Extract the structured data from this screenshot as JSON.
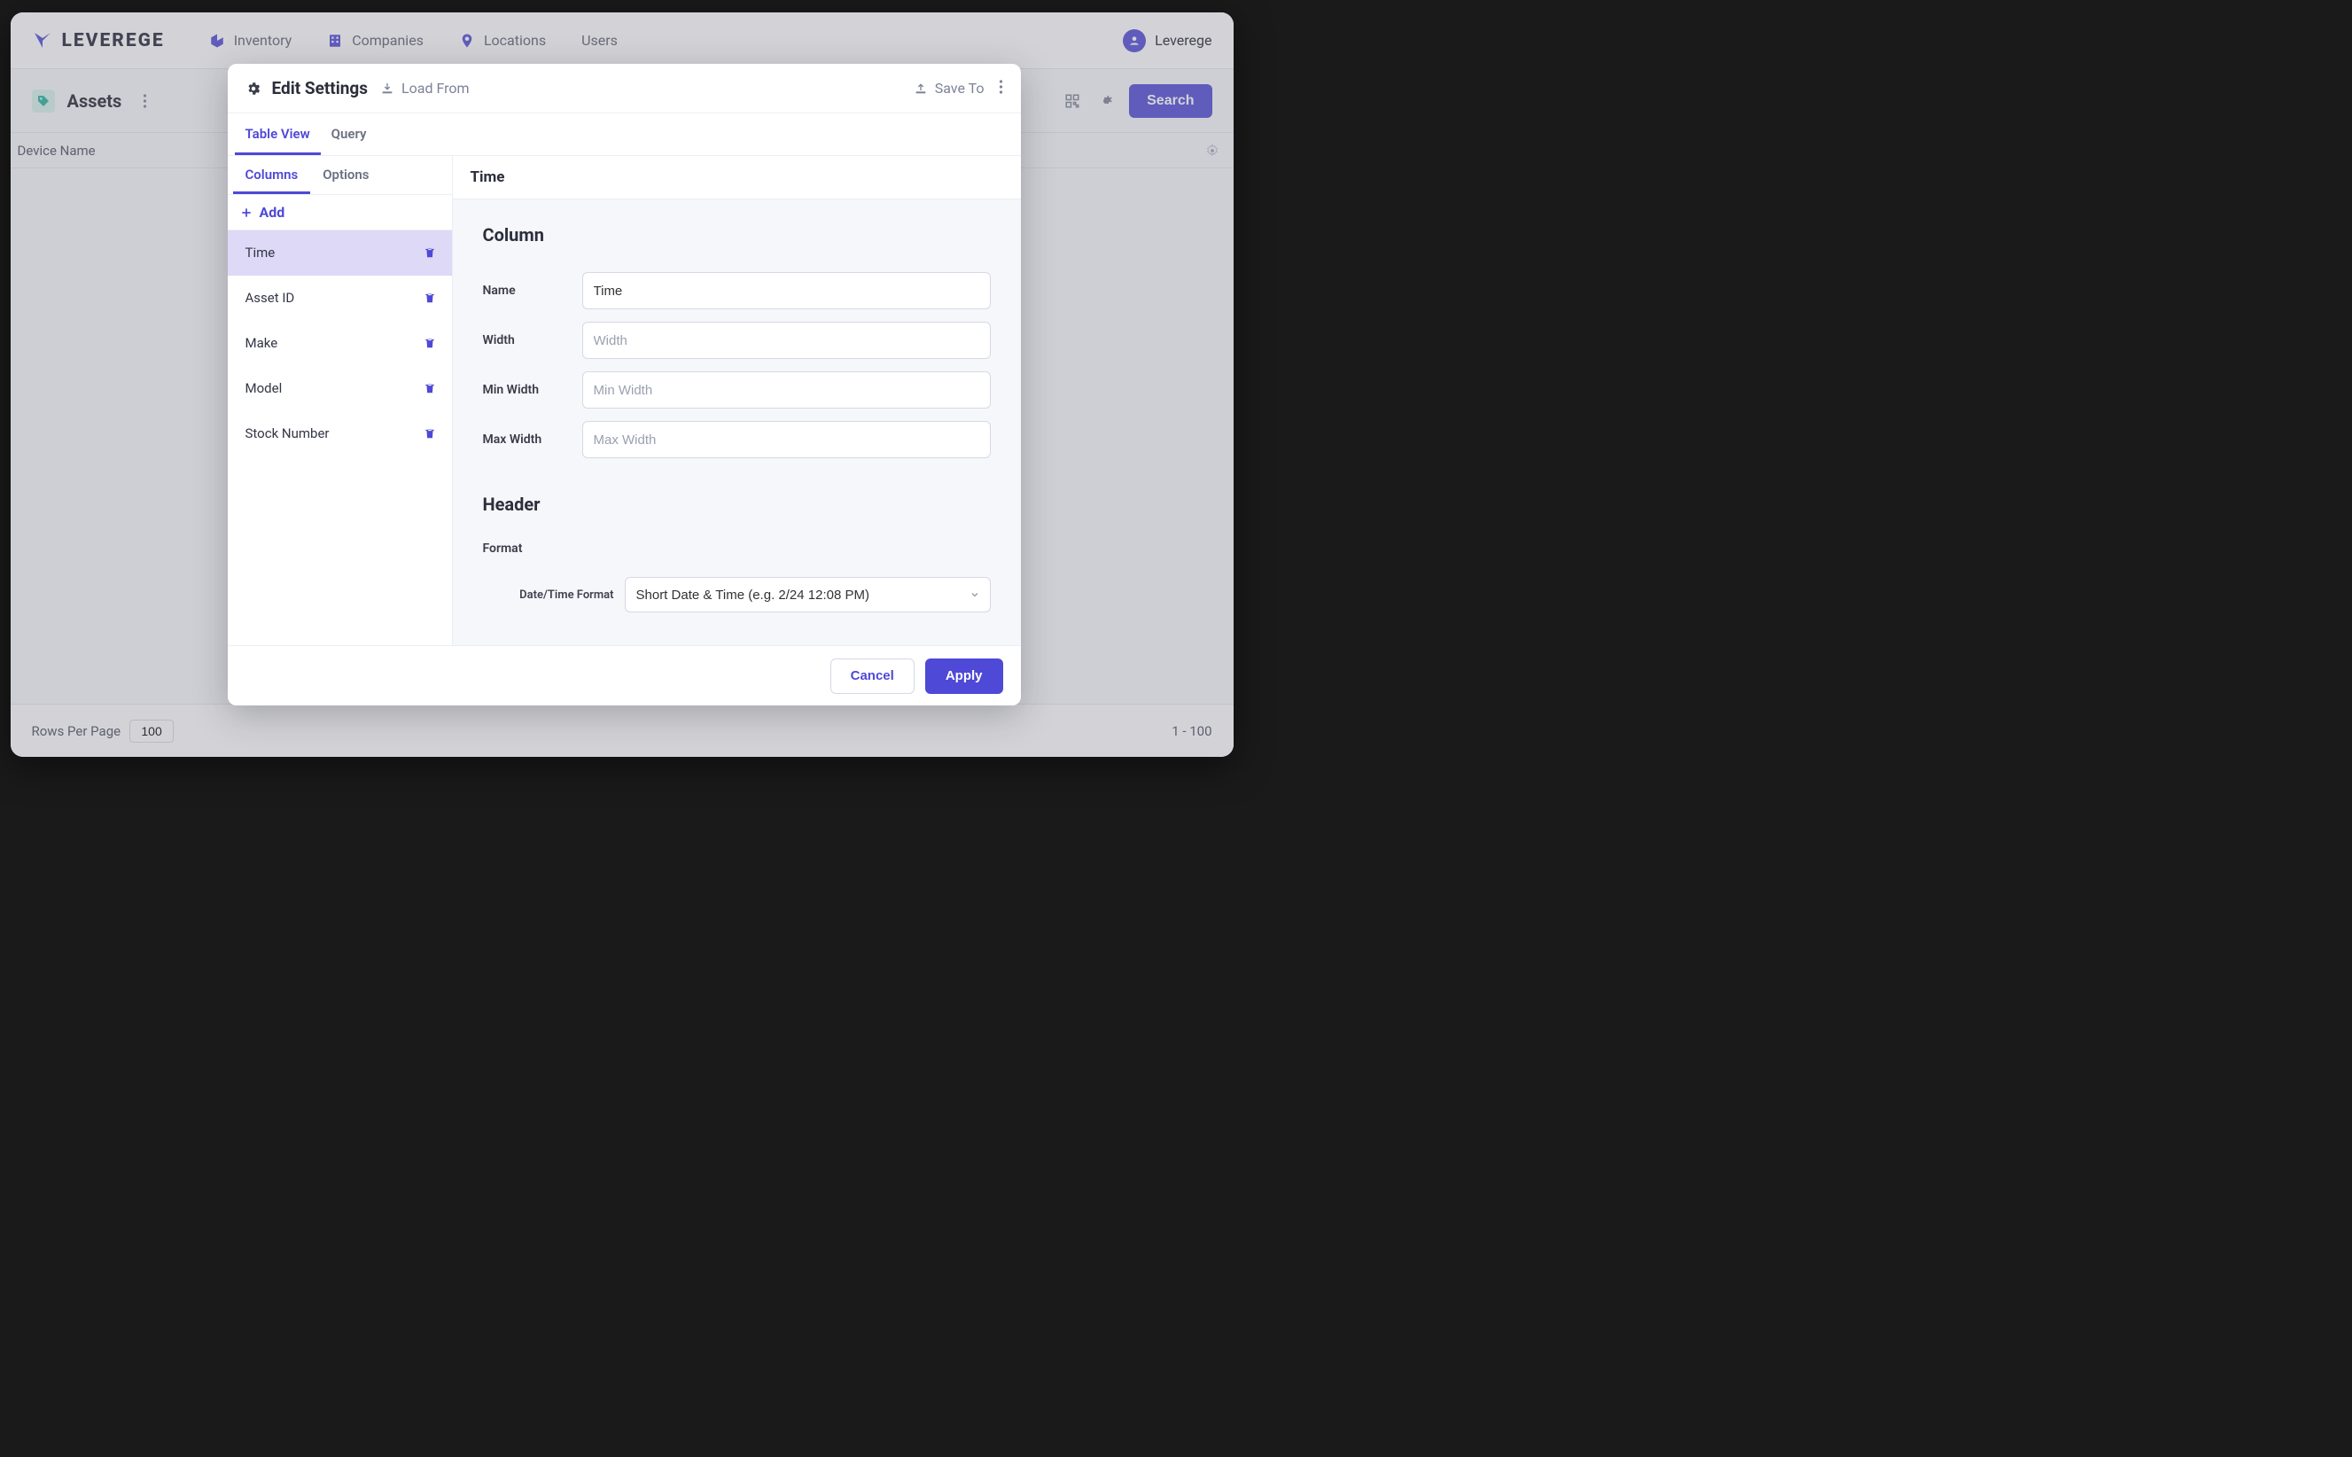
{
  "brand": {
    "name": "LEVEREGE"
  },
  "nav": {
    "items": [
      {
        "label": "Inventory",
        "icon": "cube-icon"
      },
      {
        "label": "Companies",
        "icon": "building-icon"
      },
      {
        "label": "Locations",
        "icon": "pin-icon"
      },
      {
        "label": "Users",
        "icon": null
      }
    ],
    "user": "Leverege"
  },
  "page": {
    "title": "Assets",
    "searchLabel": "Search",
    "columnHeader": "Device Name"
  },
  "footer": {
    "rowsLabel": "Rows Per Page",
    "rowsValue": "100",
    "range": "1 - 100"
  },
  "modal": {
    "title": "Edit Settings",
    "loadFrom": "Load From",
    "saveTo": "Save To",
    "tabs": [
      {
        "label": "Table View",
        "active": true
      },
      {
        "label": "Query",
        "active": false
      }
    ],
    "subtabs": [
      {
        "label": "Columns",
        "active": true
      },
      {
        "label": "Options",
        "active": false
      }
    ],
    "addLabel": "Add",
    "columns": [
      {
        "label": "Time",
        "selected": true
      },
      {
        "label": "Asset ID",
        "selected": false
      },
      {
        "label": "Make",
        "selected": false
      },
      {
        "label": "Model",
        "selected": false
      },
      {
        "label": "Stock Number",
        "selected": false
      }
    ],
    "editor": {
      "title": "Time",
      "sections": {
        "column": {
          "heading": "Column",
          "nameLabel": "Name",
          "nameValue": "Time",
          "widthLabel": "Width",
          "widthPlaceholder": "Width",
          "minWidthLabel": "Min Width",
          "minWidthPlaceholder": "Min Width",
          "maxWidthLabel": "Max Width",
          "maxWidthPlaceholder": "Max Width"
        },
        "header": {
          "heading": "Header",
          "formatLabel": "Format",
          "dtFormatLabel": "Date/Time Format",
          "dtFormatValue": "Short Date & Time (e.g. 2/24 12:08 PM)"
        }
      }
    },
    "cancel": "Cancel",
    "apply": "Apply"
  }
}
